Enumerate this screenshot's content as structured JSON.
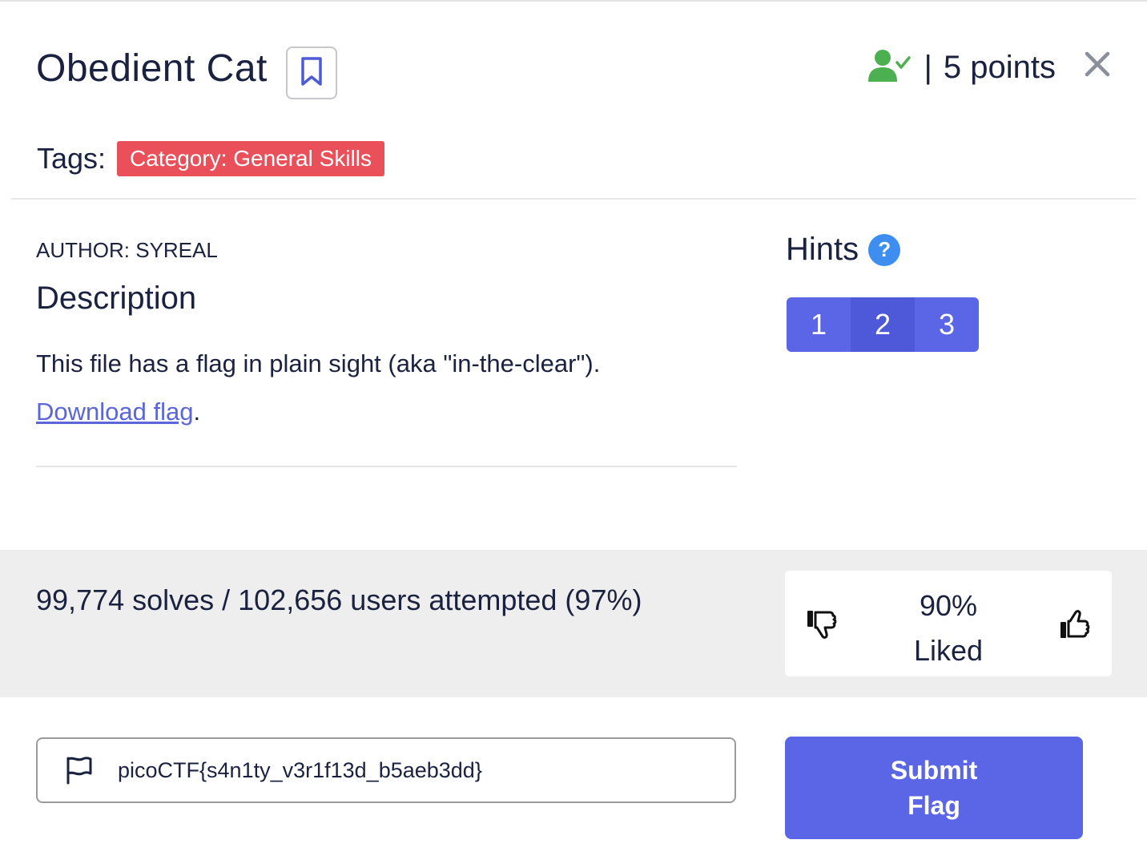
{
  "challenge": {
    "title": "Obedient Cat",
    "points_label": "5 points",
    "separator": "|"
  },
  "tags": {
    "label": "Tags:",
    "items": [
      "Category: General Skills"
    ]
  },
  "content": {
    "author": "AUTHOR: SYREAL",
    "description_title": "Description",
    "description_text": "This file has a flag in plain sight (aka \"in-the-clear\").",
    "download_link_text": "Download flag",
    "download_suffix": "."
  },
  "hints": {
    "title": "Hints",
    "help_symbol": "?",
    "buttons": [
      "1",
      "2",
      "3"
    ]
  },
  "stats": {
    "solves_text": "99,774 solves / 102,656 users attempted (97%)",
    "liked_percent": "90%",
    "liked_label": "Liked"
  },
  "flag": {
    "value": "picoCTF{s4n1ty_v3r1f13d_b5aeb3dd}",
    "submit_label": "Submit Flag"
  },
  "icons": {
    "bookmark": "bookmark-icon",
    "solved_user": "user-check-icon",
    "close": "close-icon",
    "help": "help-icon",
    "thumbs_down": "thumbs-down-icon",
    "thumbs_up": "thumbs-up-icon",
    "flag": "flag-icon"
  },
  "colors": {
    "accent": "#5b66e6",
    "tag": "#e9505a",
    "solved": "#4caf50",
    "help": "#3d8ef0",
    "link": "#5a66d9"
  }
}
